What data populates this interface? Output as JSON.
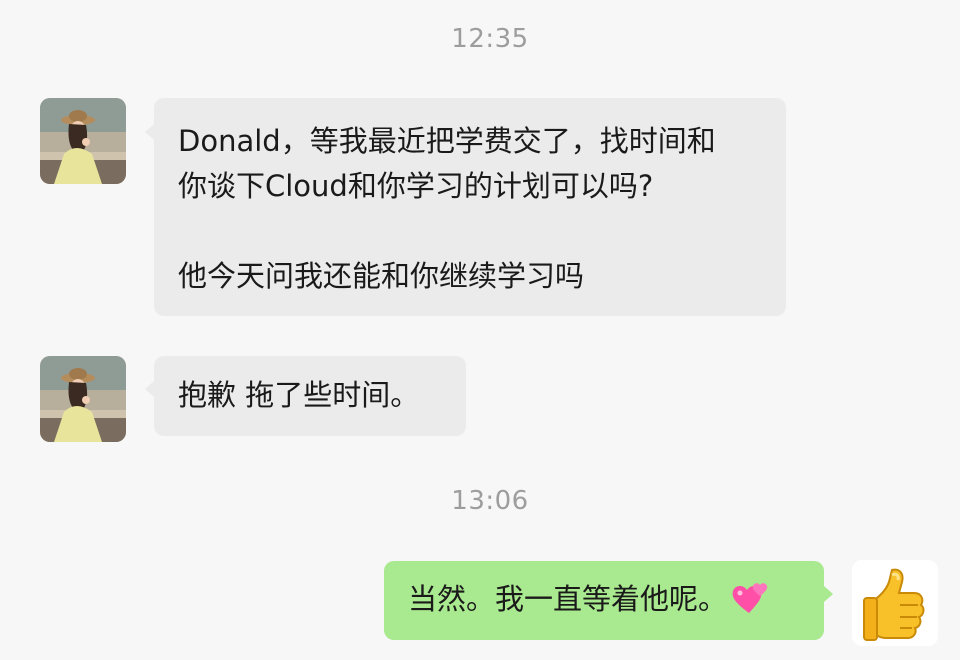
{
  "chat": {
    "timestamps": [
      "12:35",
      "13:06"
    ],
    "messages": [
      {
        "sender": "contact",
        "lines": [
          "Donald，等我最近把学费交了，找时间和",
          "你谈下Cloud和你学习的计划可以吗?",
          "",
          "他今天问我还能和你继续学习吗"
        ]
      },
      {
        "sender": "contact",
        "lines": [
          "抱歉 拖了些时间。"
        ]
      },
      {
        "sender": "me",
        "text": "当然。我一直等着他呢。",
        "emoji": "two-hearts-icon"
      }
    ],
    "avatars": {
      "contact": "avatar-photo",
      "me": "thumbs-up-sticker-icon"
    },
    "colors": {
      "background": "#f7f7f7",
      "incoming_bubble": "#ebebeb",
      "outgoing_bubble": "#a9e98f",
      "timestamp": "#9d9d9d"
    }
  }
}
